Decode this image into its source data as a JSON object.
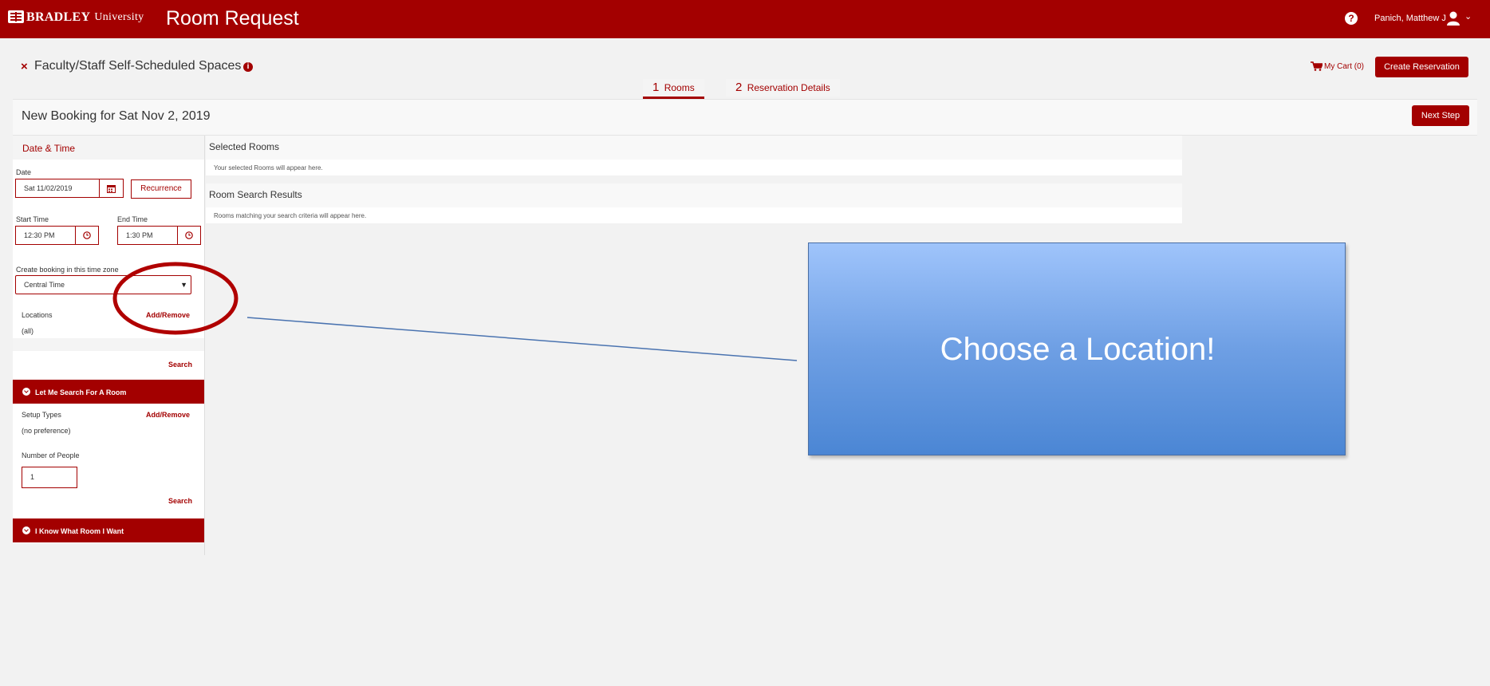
{
  "header": {
    "logo_name": "BRADLEY",
    "logo_sub": "University",
    "app_title": "Room Request",
    "help_glyph": "?",
    "user_name": "Panich, Matthew J",
    "user_caret": "⌄"
  },
  "page": {
    "title": "Faculty/Staff Self-Scheduled Spaces",
    "cart_label": "My Cart (0)",
    "create_button": "Create Reservation"
  },
  "steps": [
    {
      "num": "1",
      "label": "Rooms"
    },
    {
      "num": "2",
      "label": "Reservation Details"
    }
  ],
  "booking": {
    "title": "New Booking for Sat Nov 2, 2019",
    "next_button": "Next Step"
  },
  "left": {
    "datetime_title": "Date & Time",
    "date_label": "Date",
    "date_value": "Sat 11/02/2019",
    "recurrence_button": "Recurrence",
    "start_label": "Start Time",
    "start_value": "12:30 PM",
    "end_label": "End Time",
    "end_value": "1:30 PM",
    "tz_label": "Create booking in this time zone",
    "tz_value": "Central Time",
    "locations_label": "Locations",
    "locations_link": "Add/Remove",
    "locations_value": "(all)",
    "search_link": "Search",
    "search_section": "Let Me Search For A Room",
    "setup_label": "Setup Types",
    "setup_link": "Add/Remove",
    "setup_value": "(no preference)",
    "people_label": "Number of People",
    "people_value": "1",
    "search_link2": "Search",
    "know_section": "I Know What Room I Want"
  },
  "main": {
    "selected_title": "Selected Rooms",
    "selected_empty": "Your selected Rooms will appear here.",
    "results_title": "Room Search Results",
    "results_empty": "Rooms matching your search criteria will appear here."
  },
  "annotation": {
    "callout_text": "Choose a Location!"
  },
  "icons": {
    "logo": "bradley-logo-icon",
    "help": "help-icon",
    "user": "user-icon",
    "close": "close-icon",
    "info": "info-icon",
    "cart": "cart-icon",
    "calendar": "calendar-icon",
    "clock": "clock-icon",
    "select": "caret-down-icon",
    "expand": "chevron-circle-icon"
  },
  "colors": {
    "brand": "#a30000",
    "background": "#f2f2f2",
    "callout": "#6e9fe4",
    "annotation_circle": "#b00000",
    "annotation_line": "#4a73b0"
  }
}
